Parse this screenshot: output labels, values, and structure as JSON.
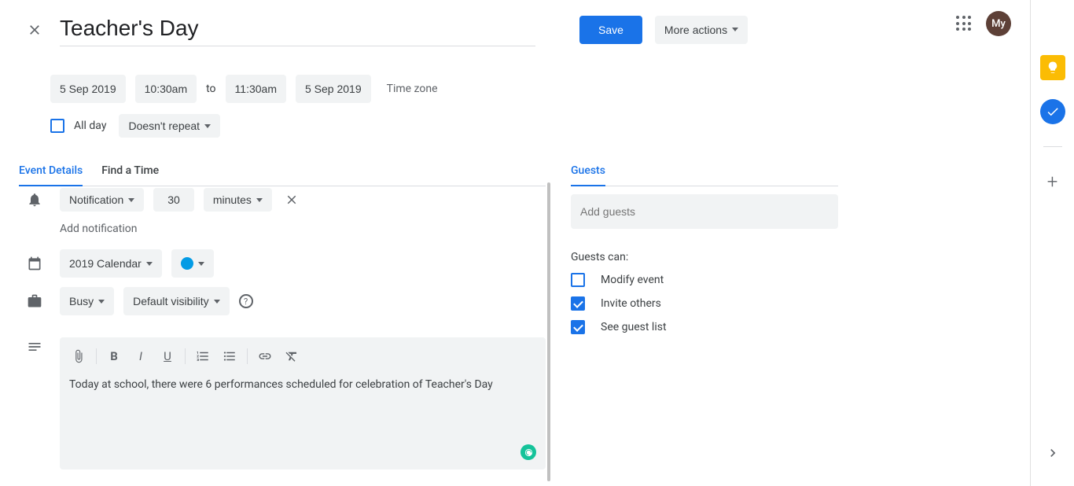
{
  "header": {
    "title": "Teacher's Day",
    "save_label": "Save",
    "more_label": "More actions",
    "avatar_text": "My"
  },
  "datetime": {
    "start_date": "5 Sep 2019",
    "start_time": "10:30am",
    "to": "to",
    "end_time": "11:30am",
    "end_date": "5 Sep 2019",
    "timezone_label": "Time zone",
    "all_day_label": "All day",
    "repeat_label": "Doesn't repeat"
  },
  "tabs": {
    "details": "Event Details",
    "find_time": "Find a Time"
  },
  "notification": {
    "type": "Notification",
    "value": "30",
    "unit": "minutes",
    "add_label": "Add notification"
  },
  "calendar": {
    "name": "2019 Calendar",
    "color": "#039be5"
  },
  "visibility": {
    "availability": "Busy",
    "visibility": "Default visibility"
  },
  "description": {
    "text": "Today at school, there were 6 performances scheduled for celebration of Teacher's Day"
  },
  "guests": {
    "tab_label": "Guests",
    "placeholder": "Add guests",
    "can_label": "Guests can:",
    "perm_modify": "Modify event",
    "perm_invite": "Invite others",
    "perm_see": "See guest list"
  }
}
